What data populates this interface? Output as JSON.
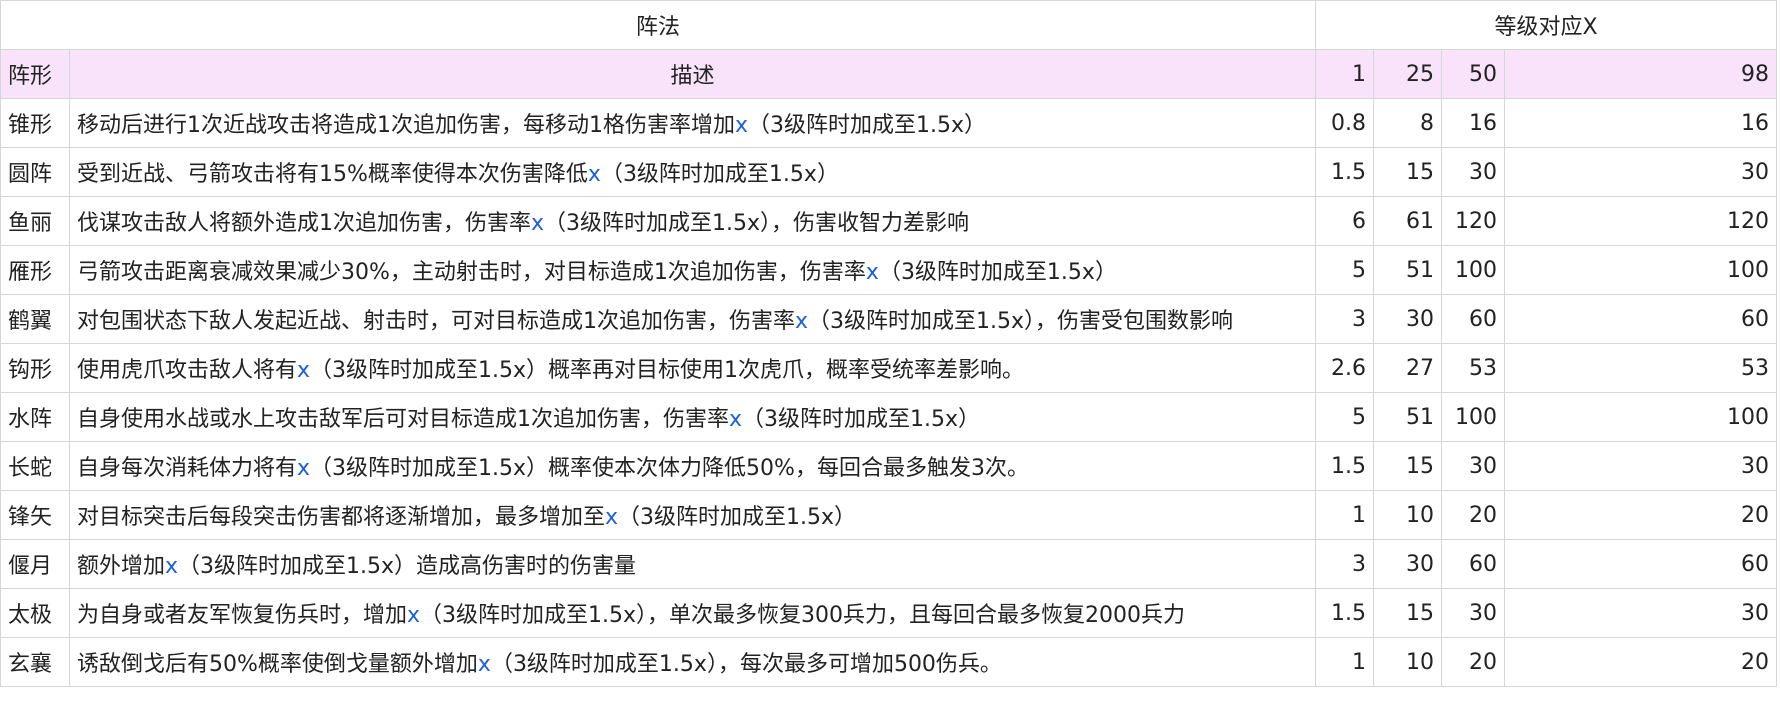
{
  "header": {
    "formation_title": "阵法",
    "level_title": "等级对应X",
    "col_name": "阵形",
    "col_desc": "描述",
    "levels": [
      "1",
      "25",
      "50",
      "98"
    ]
  },
  "rows": [
    {
      "name": "锥形",
      "desc": [
        {
          "t": "移动后进行1次近战攻击将造成1次追加伤害，每移动1格伤害率增加"
        },
        {
          "t": "x",
          "hl": true
        },
        {
          "t": "（3级阵时加成至1.5x）"
        }
      ],
      "values": [
        "0.8",
        "8",
        "16",
        "16"
      ]
    },
    {
      "name": "圆阵",
      "desc": [
        {
          "t": "受到近战、弓箭攻击将有15%概率使得本次伤害降低"
        },
        {
          "t": "x",
          "hl": true
        },
        {
          "t": "（3级阵时加成至1.5x）"
        }
      ],
      "values": [
        "1.5",
        "15",
        "30",
        "30"
      ]
    },
    {
      "name": "鱼丽",
      "desc": [
        {
          "t": "伐谋攻击敌人将额外造成1次追加伤害，伤害率"
        },
        {
          "t": "x",
          "hl": true
        },
        {
          "t": "（3级阵时加成至1.5x），伤害收智力差影响"
        }
      ],
      "values": [
        "6",
        "61",
        "120",
        "120"
      ]
    },
    {
      "name": "雁形",
      "desc": [
        {
          "t": "弓箭攻击距离衰减效果减少30%，主动射击时，对目标造成1次追加伤害，伤害率"
        },
        {
          "t": "x",
          "hl": true
        },
        {
          "t": "（3级阵时加成至1.5x）"
        }
      ],
      "values": [
        "5",
        "51",
        "100",
        "100"
      ]
    },
    {
      "name": "鹤翼",
      "desc": [
        {
          "t": "对包围状态下敌人发起近战、射击时，可对目标造成1次追加伤害，伤害率"
        },
        {
          "t": "x",
          "hl": true
        },
        {
          "t": "（3级阵时加成至1.5x），伤害受包围数影响"
        }
      ],
      "values": [
        "3",
        "30",
        "60",
        "60"
      ]
    },
    {
      "name": "钩形",
      "desc": [
        {
          "t": "使用虎爪攻击敌人将有"
        },
        {
          "t": "x",
          "hl": true
        },
        {
          "t": "（3级阵时加成至1.5x）概率再对目标使用1次虎爪，概率受统率差影响。"
        }
      ],
      "values": [
        "2.6",
        "27",
        "53",
        "53"
      ]
    },
    {
      "name": "水阵",
      "desc": [
        {
          "t": "自身使用水战或水上攻击敌军后可对目标造成1次追加伤害，伤害率"
        },
        {
          "t": "x",
          "hl": true
        },
        {
          "t": "（3级阵时加成至1.5x）"
        }
      ],
      "values": [
        "5",
        "51",
        "100",
        "100"
      ]
    },
    {
      "name": "长蛇",
      "desc": [
        {
          "t": "自身每次消耗体力将有"
        },
        {
          "t": "x",
          "hl": true
        },
        {
          "t": "（3级阵时加成至1.5x）概率使本次体力降低50%，每回合最多触发3次。"
        }
      ],
      "values": [
        "1.5",
        "15",
        "30",
        "30"
      ]
    },
    {
      "name": "锋矢",
      "desc": [
        {
          "t": "对目标突击后每段突击伤害都将逐渐增加，最多增加至"
        },
        {
          "t": "x",
          "hl": true
        },
        {
          "t": "（3级阵时加成至1.5x）"
        }
      ],
      "values": [
        "1",
        "10",
        "20",
        "20"
      ]
    },
    {
      "name": "偃月",
      "desc": [
        {
          "t": "额外增加"
        },
        {
          "t": "x",
          "hl": true
        },
        {
          "t": "（3级阵时加成至1.5x）造成高伤害时的伤害量"
        }
      ],
      "values": [
        "3",
        "30",
        "60",
        "60"
      ]
    },
    {
      "name": "太极",
      "desc": [
        {
          "t": "为自身或者友军恢复伤兵时，增加"
        },
        {
          "t": "x",
          "hl": true
        },
        {
          "t": "（3级阵时加成至1.5x），单次最多恢复300兵力，且每回合最多恢复2000兵力"
        }
      ],
      "values": [
        "1.5",
        "15",
        "30",
        "30"
      ]
    },
    {
      "name": "玄襄",
      "desc": [
        {
          "t": "诱敌倒戈后有50%概率使倒戈量额外增加"
        },
        {
          "t": "x",
          "hl": true
        },
        {
          "t": "（3级阵时加成至1.5x），每次最多可增加500伤兵。"
        }
      ],
      "values": [
        "1",
        "10",
        "20",
        "20"
      ]
    }
  ],
  "colors": {
    "header_bg": "#f8e3fb",
    "highlight": "#1a5fe0",
    "border": "#d6d6d6"
  }
}
